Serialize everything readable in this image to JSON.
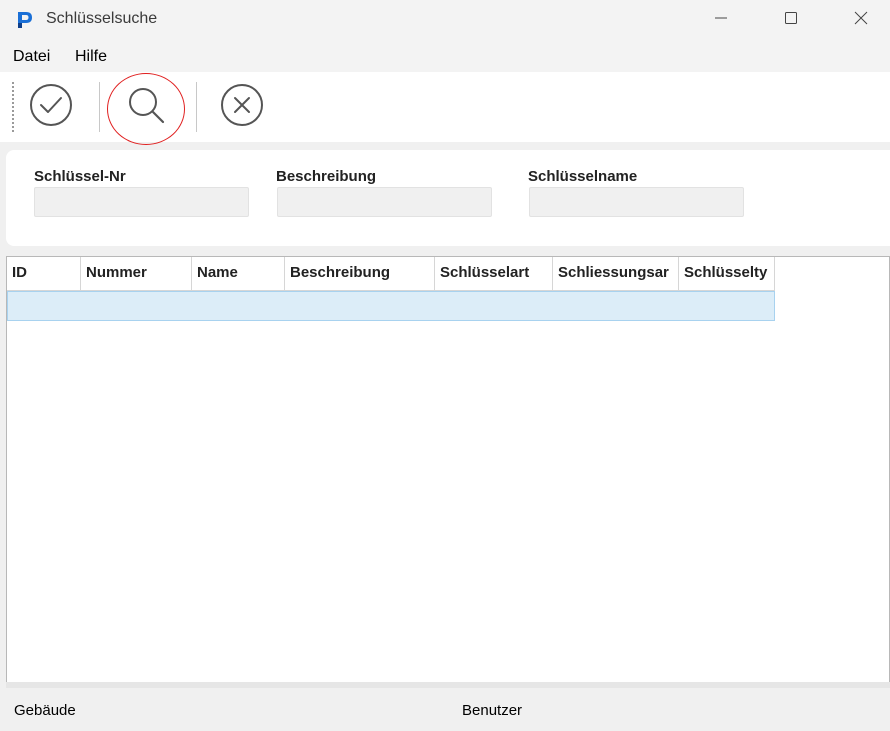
{
  "window": {
    "title": "Schlüsselsuche",
    "app_icon": "p-logo-icon",
    "accent": "#1a6fd6"
  },
  "menu": {
    "items": [
      {
        "label": "Datei"
      },
      {
        "label": "Hilfe"
      }
    ]
  },
  "toolbar": {
    "buttons": [
      {
        "icon": "checkmark-circle-icon"
      },
      {
        "icon": "search-icon",
        "highlighted": true
      },
      {
        "icon": "x-circle-icon"
      }
    ],
    "highlight_color": "#e02020"
  },
  "search": {
    "fields": [
      {
        "label": "Schlüssel-Nr",
        "value": ""
      },
      {
        "label": "Beschreibung",
        "value": ""
      },
      {
        "label": "Schlüsselname",
        "value": ""
      }
    ]
  },
  "grid": {
    "columns": [
      "ID",
      "Nummer",
      "Name",
      "Beschreibung",
      "Schlüsselart",
      "Schliessungsar",
      "Schlüsselty"
    ],
    "rows": [
      {
        "cells": [
          "",
          "",
          "",
          "",
          "",
          "",
          ""
        ],
        "selected": true
      }
    ],
    "selection_color": "#dcedf8"
  },
  "status": {
    "left": "Gebäude",
    "center": "Benutzer"
  }
}
